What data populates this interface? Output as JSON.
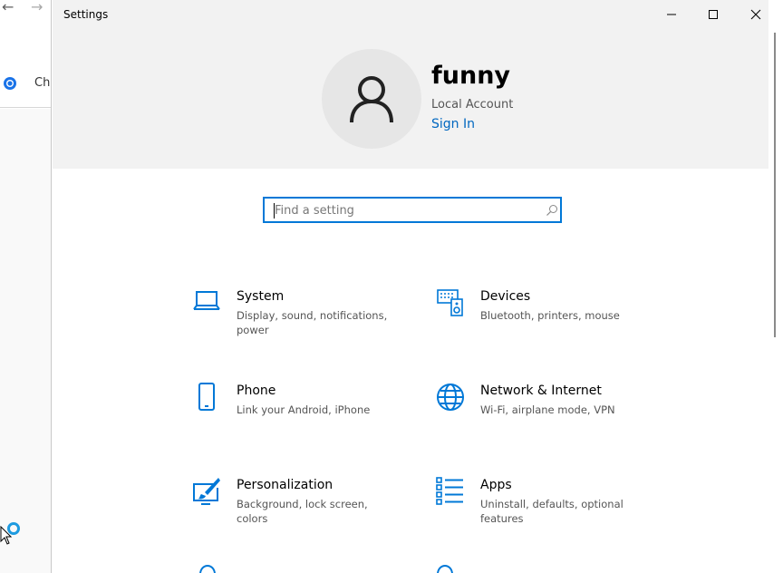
{
  "background": {
    "tab_label": "Chr",
    "icons": [
      "back-arrow-icon",
      "forward-arrow-icon",
      "chrome-icon",
      "circle-icon",
      "cursor-icon"
    ]
  },
  "window": {
    "title": "Settings",
    "controls": [
      "minimize-icon",
      "maximize-icon",
      "close-icon"
    ]
  },
  "account": {
    "username": "funny",
    "type": "Local Account",
    "sign_in": "Sign In",
    "avatar_icon": "person-icon"
  },
  "search": {
    "placeholder": "Find a setting",
    "icon": "search-icon"
  },
  "categories": [
    {
      "title": "System",
      "desc": "Display, sound, notifications, power",
      "icon": "laptop-icon"
    },
    {
      "title": "Devices",
      "desc": "Bluetooth, printers, mouse",
      "icon": "keyboard-speaker-icon"
    },
    {
      "title": "Phone",
      "desc": "Link your Android, iPhone",
      "icon": "phone-icon"
    },
    {
      "title": "Network & Internet",
      "desc": "Wi-Fi, airplane mode, VPN",
      "icon": "globe-icon"
    },
    {
      "title": "Personalization",
      "desc": "Background, lock screen, colors",
      "icon": "paintbrush-icon"
    },
    {
      "title": "Apps",
      "desc": "Uninstall, defaults, optional features",
      "icon": "apps-list-icon"
    }
  ],
  "colors": {
    "accent": "#0078d7",
    "link": "#0067c0",
    "header_bg": "#f2f2f2"
  }
}
